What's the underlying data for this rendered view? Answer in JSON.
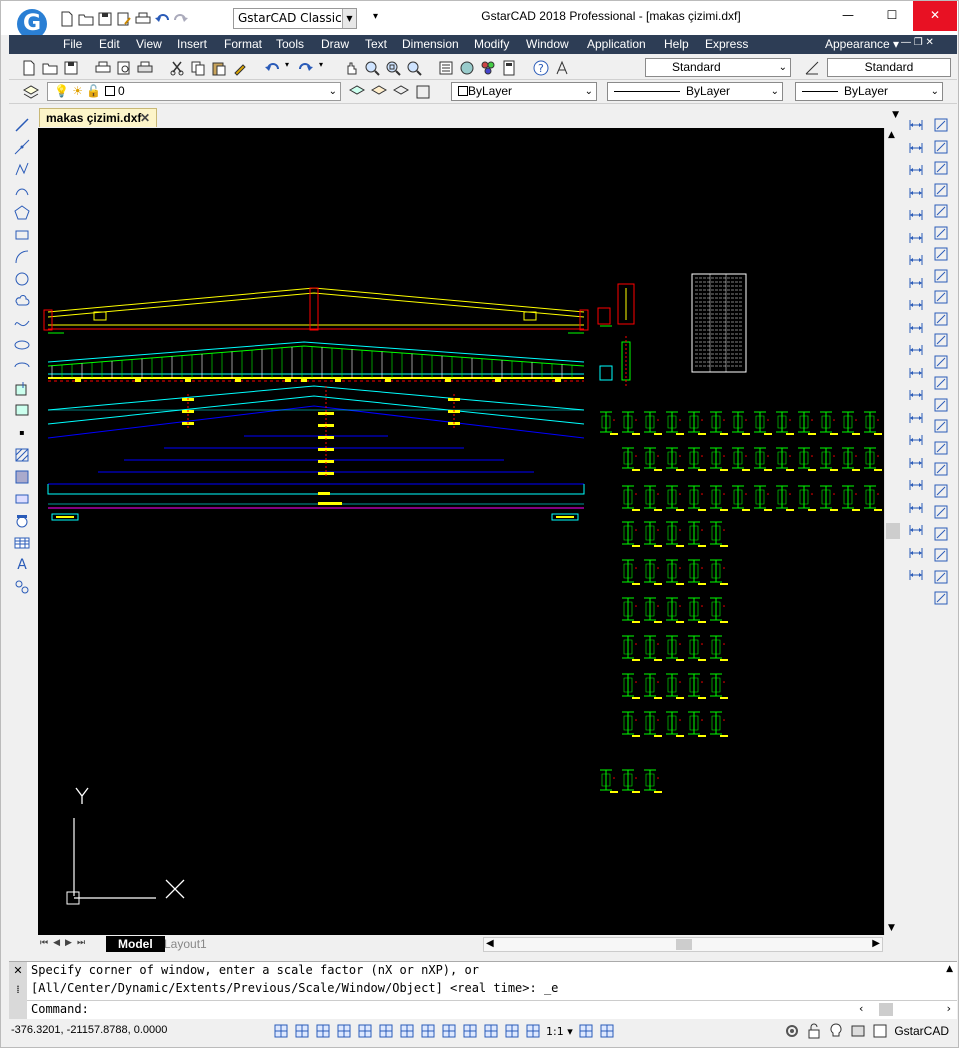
{
  "window": {
    "title": "GstarCAD 2018 Professional - [makas çizimi.dxf]",
    "logo_letter": "G",
    "workspace": "GstarCAD Classic",
    "minimize": "—",
    "maximize": "☐",
    "close": "✕"
  },
  "menu": {
    "items": [
      "File",
      "Edit",
      "View",
      "Insert",
      "Format",
      "Tools",
      "Draw",
      "Text",
      "Dimension",
      "Modify",
      "Window",
      "Application",
      "Help",
      "Express"
    ],
    "appearance": "Appearance",
    "mdi_controls": "—  ❐  ✕"
  },
  "toolbar2": {
    "text_style": "Standard",
    "dim_style": "Standard"
  },
  "layers": {
    "current_layer": "0",
    "color": "ByLayer",
    "linetype": "ByLayer",
    "lineweight": "ByLayer"
  },
  "document": {
    "tab_label": "makas çizimi.dxf",
    "tab_close": "✕"
  },
  "ucs": {
    "y_label": "Y",
    "x_label": "X"
  },
  "layout_tabs": {
    "model": "Model",
    "layout1": "Layout1"
  },
  "command": {
    "line1": "Specify corner of window, enter a scale factor (nX or nXP), or",
    "line2": "[All/Center/Dynamic/Extents/Previous/Scale/Window/Object] <real time>: _e",
    "prompt": "Command:",
    "side_close": "✕",
    "side_grip": "⁞"
  },
  "status": {
    "coordinates": "-376.3201, -21157.8788, 0.0000",
    "annotation_scale": "1:1",
    "app_name": "GstarCAD"
  },
  "colors": {
    "menubar": "#2d3d55",
    "canvas": "#000000",
    "accent": "#2a7fd4"
  }
}
